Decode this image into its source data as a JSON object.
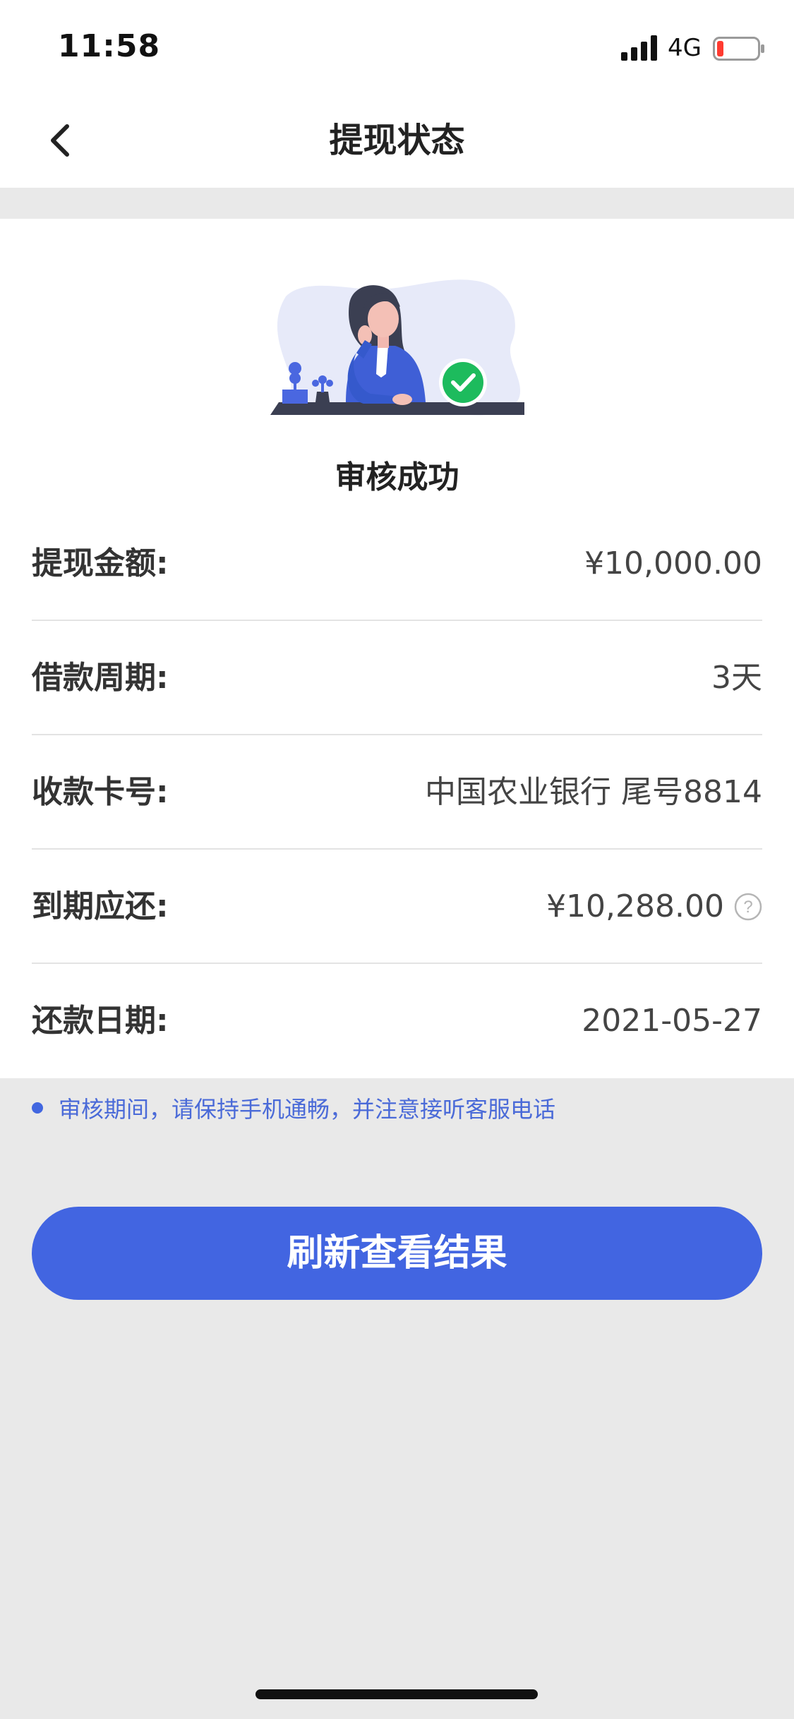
{
  "status_bar": {
    "time": "11:58",
    "network": "4G",
    "signal_icon": "cellular-signal-icon",
    "battery_icon": "battery-low-icon"
  },
  "header": {
    "title": "提现状态",
    "back_icon": "chevron-left-icon"
  },
  "result": {
    "illustration": "woman-at-desk-success-illustration",
    "status_text": "审核成功"
  },
  "details": [
    {
      "label": "提现金额:",
      "value": "¥10,000.00"
    },
    {
      "label": "借款周期:",
      "value": "3天"
    },
    {
      "label": "收款卡号:",
      "value": "中国农业银行 尾号8814"
    },
    {
      "label": "到期应还:",
      "value": "¥10,288.00",
      "help_icon": "question-circle-icon"
    },
    {
      "label": "还款日期:",
      "value": "2021-05-27"
    }
  ],
  "notice": {
    "text": "审核期间，请保持手机通畅，并注意接听客服电话"
  },
  "actions": {
    "refresh_label": "刷新查看结果"
  },
  "colors": {
    "accent": "#4265e1",
    "success": "#1dbb5d",
    "page_background": "#e9e9e9"
  }
}
